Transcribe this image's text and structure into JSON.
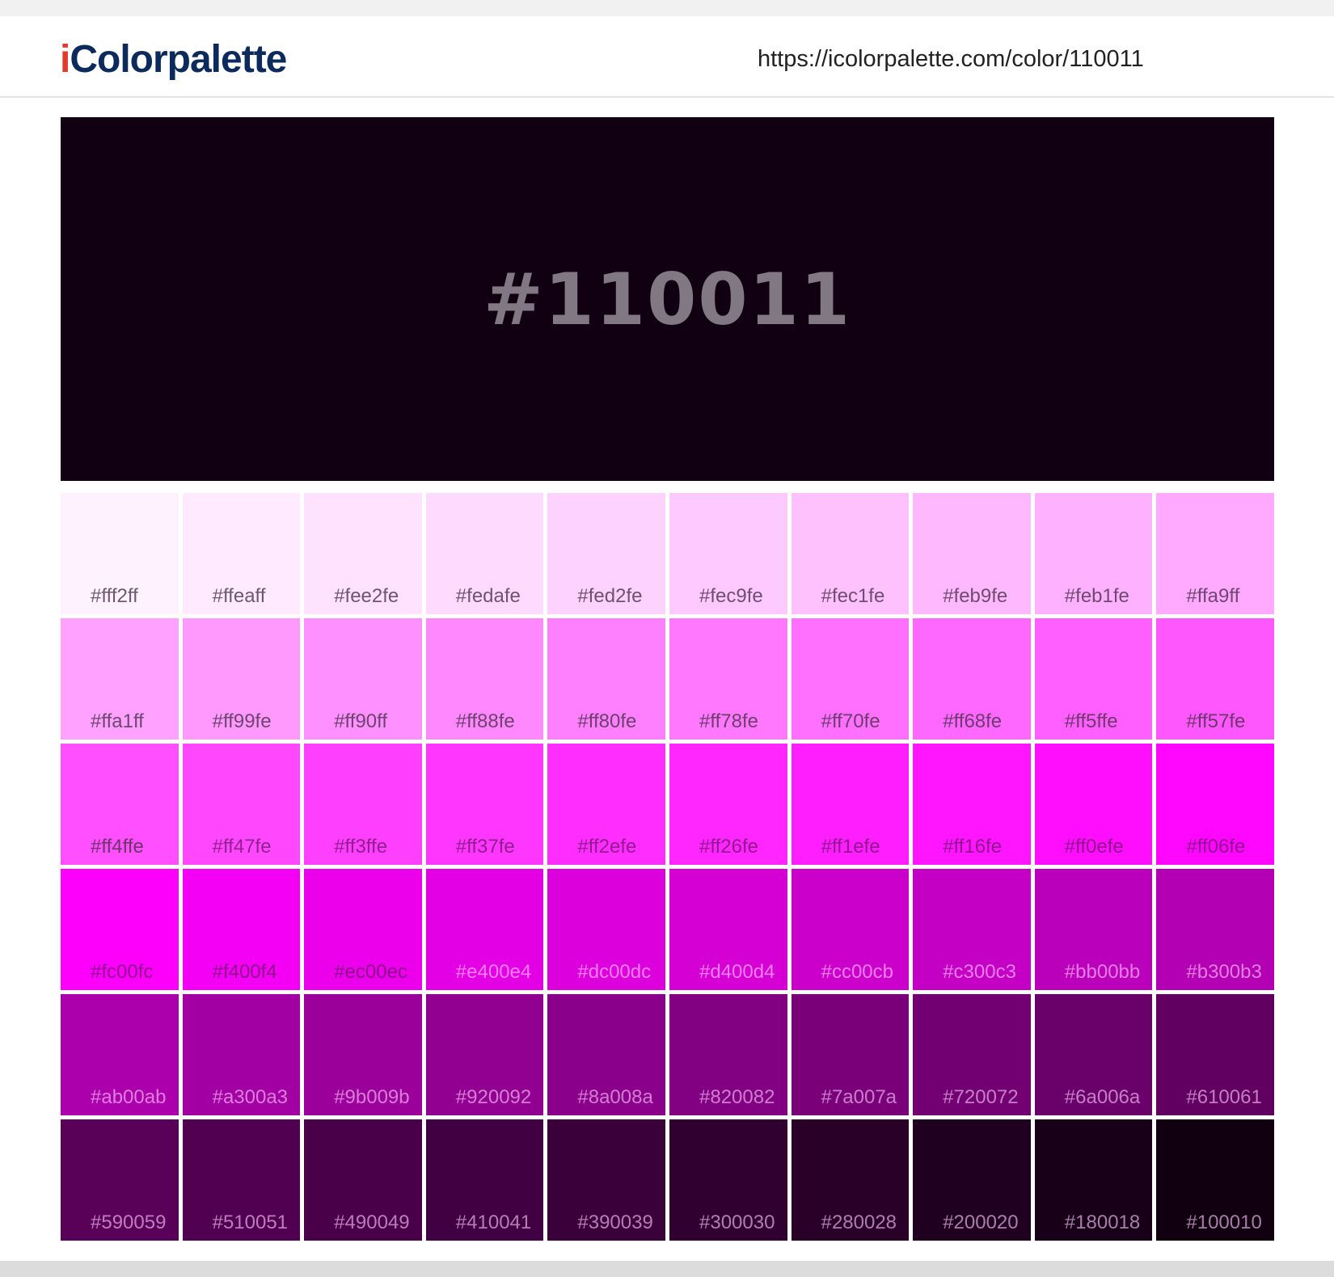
{
  "header": {
    "logo_i": "i",
    "logo_rest": "Colorpalette",
    "url": "https://icolorpalette.com/color/110011"
  },
  "hero": {
    "label": "#110011",
    "color": "#110011"
  },
  "swatches": [
    "#fff2ff",
    "#ffeaff",
    "#fee2fe",
    "#fedafe",
    "#fed2fe",
    "#fec9fe",
    "#fec1fe",
    "#feb9fe",
    "#feb1fe",
    "#ffa9ff",
    "#ffa1ff",
    "#ff99fe",
    "#ff90ff",
    "#ff88fe",
    "#ff80fe",
    "#ff78fe",
    "#ff70fe",
    "#ff68fe",
    "#ff5ffe",
    "#ff57fe",
    "#ff4ffe",
    "#ff47fe",
    "#ff3ffe",
    "#ff37fe",
    "#ff2efe",
    "#ff26fe",
    "#ff1efe",
    "#ff16fe",
    "#ff0efe",
    "#ff06fe",
    "#fc00fc",
    "#f400f4",
    "#ec00ec",
    "#e400e4",
    "#dc00dc",
    "#d400d4",
    "#cc00cb",
    "#c300c3",
    "#bb00bb",
    "#b300b3",
    "#ab00ab",
    "#a300a3",
    "#9b009b",
    "#920092",
    "#8a008a",
    "#820082",
    "#7a007a",
    "#720072",
    "#6a006a",
    "#610061",
    "#590059",
    "#510051",
    "#490049",
    "#410041",
    "#390039",
    "#300030",
    "#280028",
    "#200020",
    "#180018",
    "#100010"
  ],
  "colors": {
    "logo_dark": "#0d2a5c",
    "logo_accent": "#e23b2e",
    "hero_text": "#827883"
  }
}
